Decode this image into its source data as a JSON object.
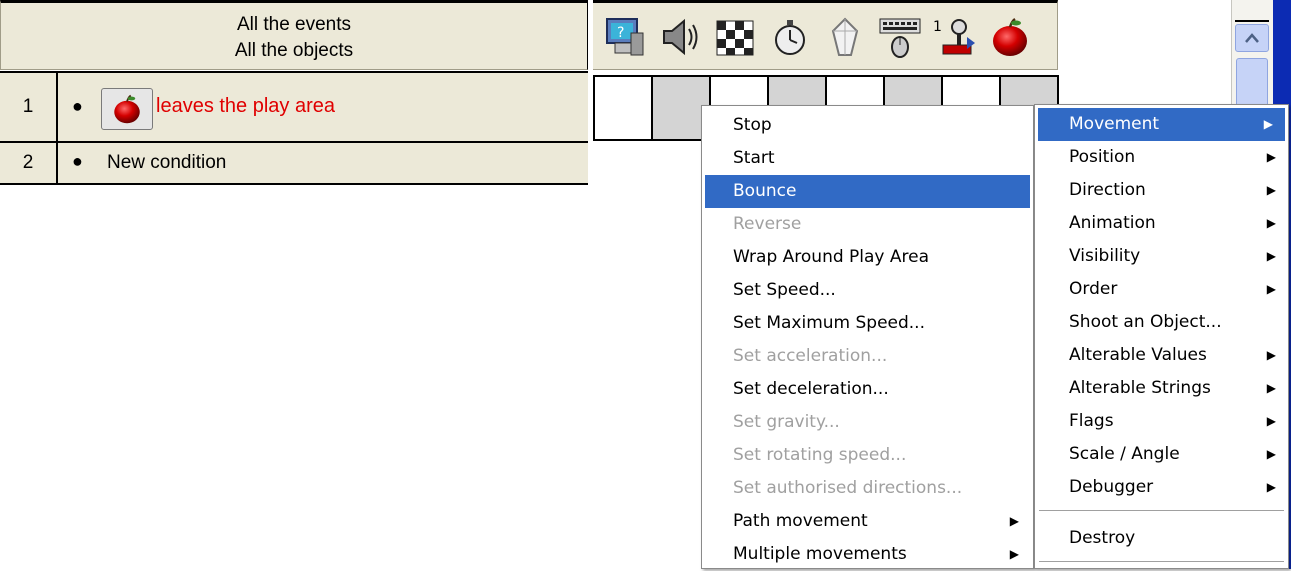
{
  "header": {
    "events_line1": "All the events",
    "events_line2": "All the objects",
    "icons": [
      "computer-question-icon",
      "speaker-icon",
      "chessboard-icon",
      "stopwatch-icon",
      "crystal-icon",
      "keyboard-mouse-icon",
      "joystick-player-icon",
      "apple-object-icon"
    ]
  },
  "events": [
    {
      "number": "1",
      "text": "leaves the play area",
      "text_color": "#e00000"
    },
    {
      "number": "2",
      "text": "New condition"
    }
  ],
  "grid": {
    "cells": 8,
    "shaded": [
      1,
      3,
      5,
      7
    ]
  },
  "context_menu": {
    "items": [
      {
        "label": "Stop",
        "disabled": false
      },
      {
        "label": "Start",
        "disabled": false
      },
      {
        "label": "Bounce",
        "disabled": false,
        "selected": true
      },
      {
        "label": "Reverse",
        "disabled": true
      },
      {
        "label": "Wrap Around Play Area",
        "disabled": false
      },
      {
        "label": "Set Speed...",
        "disabled": false
      },
      {
        "label": "Set Maximum Speed...",
        "disabled": false
      },
      {
        "label": "Set acceleration...",
        "disabled": true
      },
      {
        "label": "Set deceleration...",
        "disabled": false
      },
      {
        "label": "Set gravity...",
        "disabled": true
      },
      {
        "label": "Set rotating speed...",
        "disabled": true
      },
      {
        "label": "Set authorised directions...",
        "disabled": true
      },
      {
        "label": "Path movement",
        "disabled": false,
        "submenu": true
      },
      {
        "label": "Multiple movements",
        "disabled": false,
        "submenu": true
      }
    ]
  },
  "category_menu": {
    "items": [
      {
        "label": "Movement",
        "submenu": true,
        "selected": true
      },
      {
        "label": "Position",
        "submenu": true
      },
      {
        "label": "Direction",
        "submenu": true
      },
      {
        "label": "Animation",
        "submenu": true
      },
      {
        "label": "Visibility",
        "submenu": true
      },
      {
        "label": "Order",
        "submenu": true
      },
      {
        "label": "Shoot an Object...",
        "submenu": false
      },
      {
        "label": "Alterable Values",
        "submenu": true
      },
      {
        "label": "Alterable Strings",
        "submenu": true
      },
      {
        "label": "Flags",
        "submenu": true
      },
      {
        "label": "Scale / Angle",
        "submenu": true
      },
      {
        "label": "Debugger",
        "submenu": true
      },
      {
        "label": "Destroy",
        "submenu": false
      }
    ]
  },
  "colors": {
    "selection": "#316ac5",
    "disabled_text": "#a0a0a0",
    "header_bg": "#ece9d8",
    "window_edge": "#0c2bb3"
  }
}
